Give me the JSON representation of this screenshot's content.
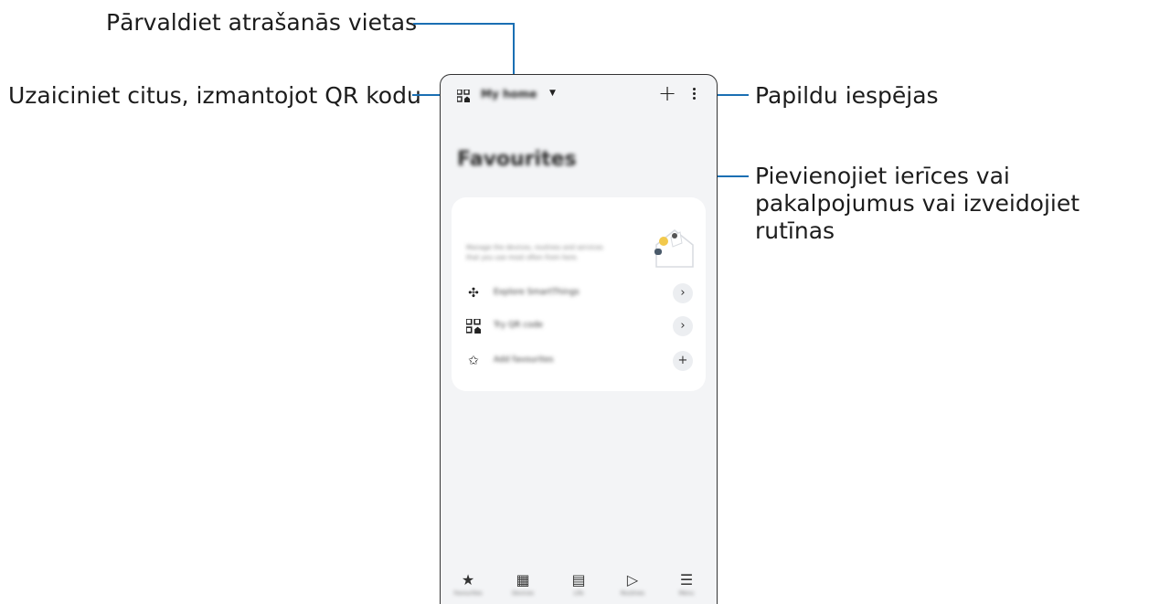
{
  "callouts": {
    "manage_locations": "Pārvaldiet atrašanās vietas",
    "invite_qr": "Uzaiciniet citus, izmantojot QR kodu",
    "more_options": "Papildu iespējas",
    "add_devices": "Pievienojiet ierīces vai pakalpojumus vai izveidojiet rutīnas"
  },
  "app": {
    "location": "My home",
    "page_title": "Favourites",
    "card_description": "Manage the devices, routines and services that you use most often from here.",
    "menu": [
      {
        "label": "Explore SmartThings",
        "icon": "fan-icon",
        "action": "›"
      },
      {
        "label": "Try QR code",
        "icon": "qr-code-icon",
        "action": "›"
      },
      {
        "label": "Add favourites",
        "icon": "star-outline-icon",
        "action": "+"
      }
    ],
    "nav": [
      {
        "label": "Favourites",
        "icon": "★"
      },
      {
        "label": "Devices",
        "icon": "▦"
      },
      {
        "label": "Life",
        "icon": "▤"
      },
      {
        "label": "Routines",
        "icon": "▷"
      },
      {
        "label": "Menu",
        "icon": "☰"
      }
    ]
  },
  "colors": {
    "leader_line": "#1a6fb3",
    "phone_background": "#f3f4f6"
  }
}
